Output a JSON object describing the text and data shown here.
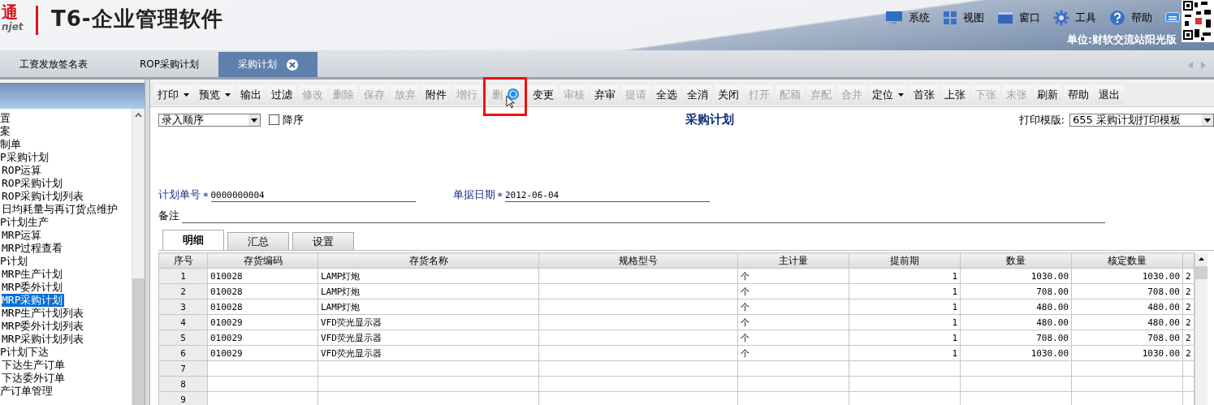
{
  "header": {
    "logo_mark": "通",
    "logo_sub": "njet",
    "product_title": "T6-企业管理软件",
    "menu": [
      {
        "label": "系统",
        "kind": "monitor"
      },
      {
        "label": "视图",
        "kind": "grid"
      },
      {
        "label": "窗口",
        "kind": "window"
      },
      {
        "label": "工具",
        "kind": "gear"
      },
      {
        "label": "帮助",
        "kind": "help"
      }
    ],
    "unit": "单位:财软交流站阳光版"
  },
  "doc_tabs": [
    {
      "label": "工资发放签名表",
      "selected": false
    },
    {
      "label": "ROP采购计划",
      "selected": false
    },
    {
      "label": "采购计划",
      "selected": true
    }
  ],
  "sidebar": {
    "items": [
      {
        "label": "置",
        "selected": false
      },
      {
        "label": "案",
        "selected": false
      },
      {
        "label": "制单",
        "selected": false
      },
      {
        "label": "P采购计划",
        "selected": false,
        "children": [
          {
            "label": "ROP运算",
            "selected": false
          },
          {
            "label": "ROP采购计划",
            "selected": false
          },
          {
            "label": "ROP采购计划列表",
            "selected": false
          },
          {
            "label": "日均耗量与再订货点维护",
            "selected": false
          }
        ]
      },
      {
        "label": "P计划生产",
        "selected": false,
        "children": [
          {
            "label": "MRP运算",
            "selected": false
          },
          {
            "label": "MRP过程查看",
            "selected": false
          }
        ]
      },
      {
        "label": "P计划",
        "selected": false,
        "children": [
          {
            "label": "MRP生产计划",
            "selected": false
          },
          {
            "label": "MRP委外计划",
            "selected": false
          },
          {
            "label": "MRP采购计划",
            "selected": true
          },
          {
            "label": "MRP生产计划列表",
            "selected": false
          },
          {
            "label": "MRP委外计划列表",
            "selected": false
          },
          {
            "label": "MRP采购计划列表",
            "selected": false
          }
        ]
      },
      {
        "label": "P计划下达",
        "selected": false,
        "children": [
          {
            "label": "下达生产订单",
            "selected": false
          },
          {
            "label": "下达委外订单",
            "selected": false
          }
        ]
      },
      {
        "label": "产订单管理",
        "selected": false
      }
    ]
  },
  "toolbar": [
    {
      "label": "打印",
      "disabled": false,
      "dropdown": true
    },
    {
      "label": "预览",
      "disabled": false,
      "dropdown": true
    },
    {
      "label": "输出",
      "disabled": false,
      "dropdown": false
    },
    {
      "label": "过滤",
      "disabled": false,
      "dropdown": false
    },
    {
      "label": "修改",
      "disabled": true,
      "dropdown": false
    },
    {
      "label": "删除",
      "disabled": true,
      "dropdown": false
    },
    {
      "label": "保存",
      "disabled": true,
      "dropdown": false
    },
    {
      "label": "放弃",
      "disabled": true,
      "dropdown": false
    },
    {
      "label": "附件",
      "disabled": false,
      "dropdown": false
    },
    {
      "label": "增行",
      "disabled": true,
      "dropdown": false
    },
    {
      "label": "删",
      "disabled": true,
      "dropdown": false
    },
    {
      "label": "变更",
      "disabled": false,
      "dropdown": false
    },
    {
      "label": "审核",
      "disabled": true,
      "dropdown": false
    },
    {
      "label": "弃审",
      "disabled": false,
      "dropdown": false
    },
    {
      "label": "提请",
      "disabled": true,
      "dropdown": false
    },
    {
      "label": "全选",
      "disabled": false,
      "dropdown": false
    },
    {
      "label": "全消",
      "disabled": false,
      "dropdown": false
    },
    {
      "label": "关闭",
      "disabled": false,
      "dropdown": false
    },
    {
      "label": "打开",
      "disabled": true,
      "dropdown": false
    },
    {
      "label": "配额",
      "disabled": true,
      "dropdown": false
    },
    {
      "label": "弃配",
      "disabled": true,
      "dropdown": false
    },
    {
      "label": "合并",
      "disabled": true,
      "dropdown": false
    },
    {
      "label": "定位",
      "disabled": false,
      "dropdown": true
    },
    {
      "label": "首张",
      "disabled": false,
      "dropdown": false
    },
    {
      "label": "上张",
      "disabled": false,
      "dropdown": false
    },
    {
      "label": "下张",
      "disabled": true,
      "dropdown": false
    },
    {
      "label": "末张",
      "disabled": true,
      "dropdown": false
    },
    {
      "label": "刷新",
      "disabled": false,
      "dropdown": false
    },
    {
      "label": "帮助",
      "disabled": false,
      "dropdown": false
    },
    {
      "label": "退出",
      "disabled": false,
      "dropdown": false
    }
  ],
  "form": {
    "sort_select": {
      "value": "录入顺序"
    },
    "descending": {
      "label": "降序",
      "checked": false
    },
    "title": "采购计划",
    "print_template": {
      "label": "打印模版:",
      "value": "655 采购计划打印模板"
    },
    "fields": [
      {
        "label": "计划单号",
        "required_mark": "*",
        "value": "0000000004"
      },
      {
        "label": "单据日期",
        "required_mark": "*",
        "value": "2012-06-04"
      }
    ],
    "remark": {
      "label": "备注"
    }
  },
  "sub_tabs": [
    {
      "label": "明细",
      "selected": true
    },
    {
      "label": "汇总",
      "selected": false
    },
    {
      "label": "设置",
      "selected": false
    }
  ],
  "table": {
    "columns": [
      "序号",
      "存货编码",
      "存货名称",
      "规格型号",
      "主计量",
      "提前期",
      "数量",
      "核定数量"
    ],
    "rows": [
      {
        "cells": [
          "1",
          "010028",
          "LAMP灯炮",
          "",
          "个",
          "1",
          "1030.00",
          "1030.00",
          "2"
        ]
      },
      {
        "cells": [
          "2",
          "010028",
          "LAMP灯炮",
          "",
          "个",
          "1",
          "708.00",
          "708.00",
          "2"
        ]
      },
      {
        "cells": [
          "3",
          "010028",
          "LAMP灯炮",
          "",
          "个",
          "1",
          "480.00",
          "480.00",
          "2"
        ]
      },
      {
        "cells": [
          "4",
          "010029",
          "VFD荧光显示器",
          "",
          "个",
          "1",
          "480.00",
          "480.00",
          "2"
        ]
      },
      {
        "cells": [
          "5",
          "010029",
          "VFD荧光显示器",
          "",
          "个",
          "1",
          "708.00",
          "708.00",
          "2"
        ]
      },
      {
        "cells": [
          "6",
          "010029",
          "VFD荧光显示器",
          "",
          "个",
          "1",
          "1030.00",
          "1030.00",
          "2"
        ]
      },
      {
        "cells": [
          "7"
        ]
      },
      {
        "cells": [
          "8"
        ]
      },
      {
        "cells": [
          "9"
        ]
      }
    ]
  }
}
